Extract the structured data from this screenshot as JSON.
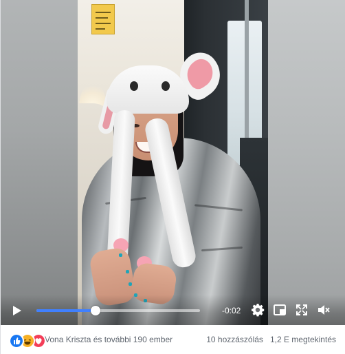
{
  "player": {
    "time_remaining": "-0:02",
    "progress_fraction": 0.36,
    "icons": {
      "play": "play-icon",
      "settings": "gear-icon",
      "pip": "picture-in-picture-icon",
      "fullscreen": "expand-icon",
      "volume": "volume-muted-icon"
    },
    "accent_color": "#4080ff"
  },
  "post_footer": {
    "reactions": [
      "like",
      "haha",
      "love"
    ],
    "reactors_text": "Vona Kriszta és további 190 ember",
    "comments_text": "10 hozzászólás",
    "views_text": "1,2 E megtekintés"
  },
  "colors": {
    "like": "#1877f2",
    "haha": "#f7b125",
    "love": "#f33e58"
  }
}
